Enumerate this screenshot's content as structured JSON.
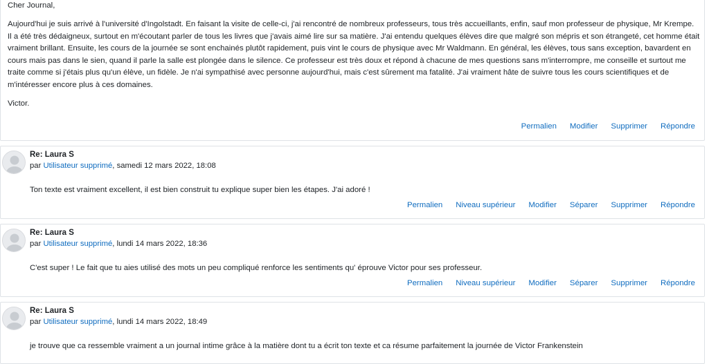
{
  "main_post": {
    "greeting": "Cher Journal,",
    "body": "Aujourd'hui je suis arrivé à l'université d'Ingolstadt. En faisant la visite de celle-ci, j'ai rencontré de nombreux professeurs, tous très accueillants, enfin, sauf mon professeur de physique, Mr Krempe. Il a été très dédaigneux, surtout en m'écoutant parler de tous les livres que j'avais aimé lire sur sa matière. J'ai entendu quelques élèves dire que malgré son mépris et son étrangeté, cet homme était vraiment brillant. Ensuite, les cours de la journée se sont enchainés plutôt rapidement, puis vint le cours de physique avec Mr Waldmann. En général, les élèves, tous sans exception, bavardent en cours mais pas dans le sien, quand il parle la salle est plongée dans le silence. Ce professeur est très doux et répond à chacune de mes questions sans m'interrompre, me conseille et surtout me traite comme si j'étais plus qu'un élève, un fidèle. Je n'ai sympathisé avec personne aujourd'hui, mais c'est sûrement ma fatalité. J'ai vraiment hâte de suivre tous les cours scientifiques et de m'intéresser encore plus à ces domaines.",
    "signature": "Victor.",
    "commands": {
      "permalink": "Permalien",
      "edit": "Modifier",
      "delete": "Supprimer",
      "reply": "Répondre"
    }
  },
  "replies": [
    {
      "subject": "Re: Laura S",
      "by": "par",
      "author": "Utilisateur supprimé",
      "date": ", samedi 12 mars 2022, 18:08",
      "text": "Ton texte est vraiment excellent, il est bien construit tu explique super bien les étapes. J'ai adoré !",
      "commands": {
        "permalink": "Permalien",
        "parent": "Niveau supérieur",
        "edit": "Modifier",
        "split": "Séparer",
        "delete": "Supprimer",
        "reply": "Répondre"
      }
    },
    {
      "subject": "Re: Laura S",
      "by": "par",
      "author": "Utilisateur supprimé",
      "date": ", lundi 14 mars 2022, 18:36",
      "text": "C'est super ! Le fait que tu aies utilisé des mots un peu compliqué renforce les sentiments qu' éprouve Victor pour ses professeur.",
      "commands": {
        "permalink": "Permalien",
        "parent": "Niveau supérieur",
        "edit": "Modifier",
        "split": "Séparer",
        "delete": "Supprimer",
        "reply": "Répondre"
      }
    },
    {
      "subject": "Re: Laura S",
      "by": "par",
      "author": "Utilisateur supprimé",
      "date": ", lundi 14 mars 2022, 18:49",
      "text": "je trouve que ca ressemble vraiment a un journal intime grâce à la matière dont tu a écrit ton texte et ca résume parfaitement la journée de Victor Frankenstein"
    }
  ],
  "colors": {
    "link": "#0f6cbf",
    "text": "#1d2125",
    "border": "#dee2e6"
  }
}
